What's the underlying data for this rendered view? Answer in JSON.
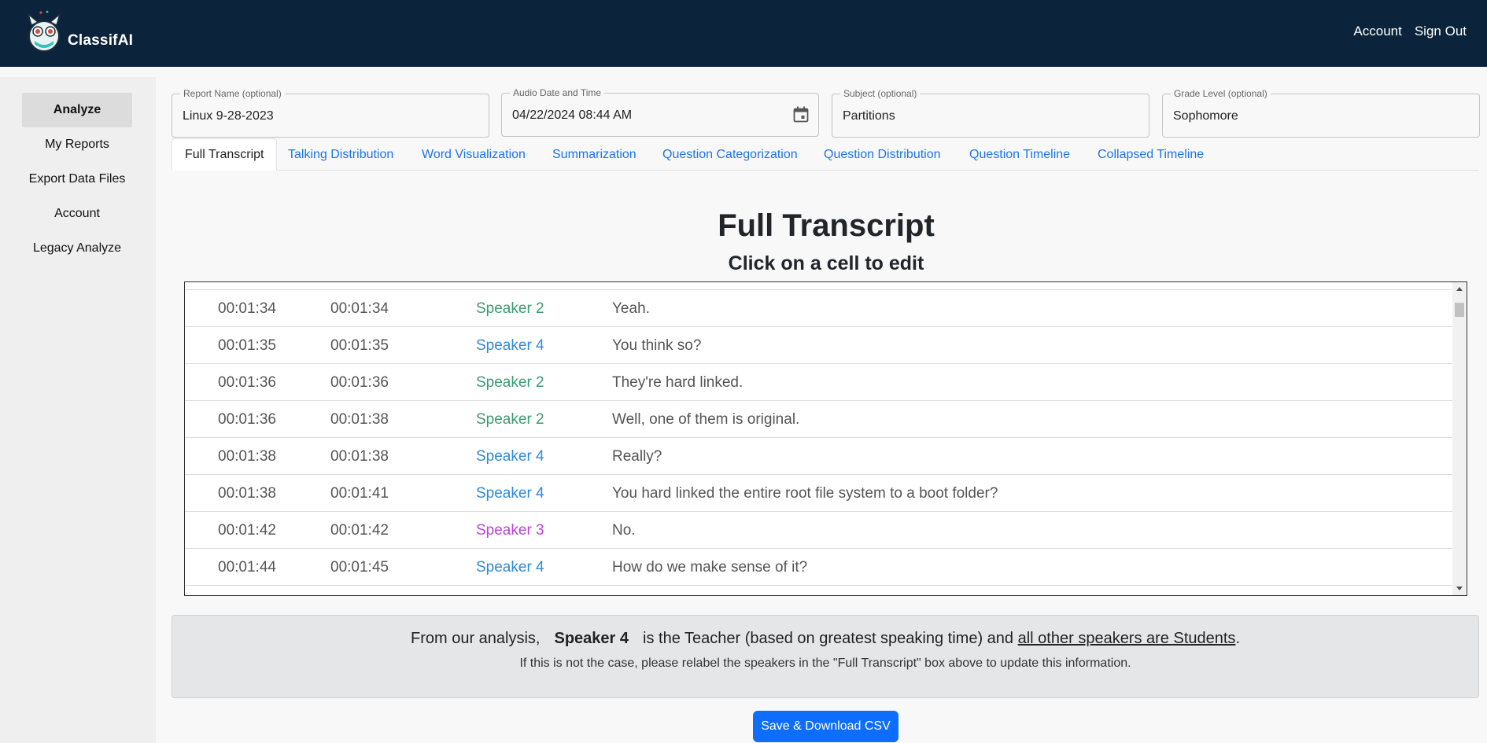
{
  "header": {
    "brand": "ClassifAI",
    "nav": {
      "account": "Account",
      "sign_out": "Sign Out"
    }
  },
  "sidebar": {
    "items": [
      {
        "label": "Analyze",
        "active": true
      },
      {
        "label": "My Reports"
      },
      {
        "label": "Export Data Files"
      },
      {
        "label": "Account"
      },
      {
        "label": "Legacy Analyze"
      }
    ]
  },
  "fields": {
    "report_name": {
      "label": "Report Name (optional)",
      "value": "Linux 9-28-2023"
    },
    "audio_date": {
      "label": "Audio Date and Time",
      "value": "04/22/2024 08:44 AM"
    },
    "subject": {
      "label": "Subject (optional)",
      "value": "Partitions"
    },
    "grade_level": {
      "label": "Grade Level (optional)",
      "value": "Sophomore"
    }
  },
  "tabs": [
    {
      "label": "Full Transcript",
      "active": true
    },
    {
      "label": "Talking Distribution"
    },
    {
      "label": "Word Visualization"
    },
    {
      "label": "Summarization"
    },
    {
      "label": "Question Categorization"
    },
    {
      "label": "Question Distribution"
    },
    {
      "label": "Question Timeline"
    },
    {
      "label": "Collapsed Timeline"
    }
  ],
  "main": {
    "title": "Full Transcript",
    "subtitle": "Click on a cell to edit"
  },
  "transcript": {
    "speaker_colors": {
      "Speaker 2": "#3a9c6f",
      "Speaker 3": "#c040d8",
      "Speaker 4": "#2e8ad8"
    },
    "rows": [
      {
        "start": "00:01:34",
        "end": "00:01:34",
        "speaker": "Speaker 2",
        "text": "Yeah."
      },
      {
        "start": "00:01:35",
        "end": "00:01:35",
        "speaker": "Speaker 4",
        "text": "You think so?"
      },
      {
        "start": "00:01:36",
        "end": "00:01:36",
        "speaker": "Speaker 2",
        "text": "They're hard linked."
      },
      {
        "start": "00:01:36",
        "end": "00:01:38",
        "speaker": "Speaker 2",
        "text": "Well, one of them is original."
      },
      {
        "start": "00:01:38",
        "end": "00:01:38",
        "speaker": "Speaker 4",
        "text": "Really?"
      },
      {
        "start": "00:01:38",
        "end": "00:01:41",
        "speaker": "Speaker 4",
        "text": "You hard linked the entire root file system to a boot folder?"
      },
      {
        "start": "00:01:42",
        "end": "00:01:42",
        "speaker": "Speaker 3",
        "text": "No."
      },
      {
        "start": "00:01:44",
        "end": "00:01:45",
        "speaker": "Speaker 4",
        "text": "How do we make sense of it?"
      }
    ]
  },
  "analysis": {
    "prefix": "From our analysis,",
    "speaker": "Speaker 4",
    "middle": "is the Teacher (based on greatest speaking time) and",
    "link": "all other speakers are Students",
    "suffix": ".",
    "note": "If this is not the case, please relabel the speakers in the \"Full Transcript\" box above to update this information."
  },
  "actions": {
    "save_csv": "Save & Download CSV"
  },
  "colors": {
    "header_bg": "#0b243b",
    "accent": "#0d6efd",
    "tab_link": "#1e73e8"
  }
}
